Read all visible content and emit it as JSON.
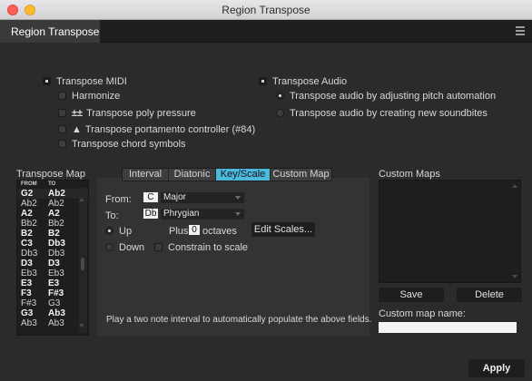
{
  "window": {
    "title": "Region Transpose"
  },
  "tab": {
    "label": "Region Transpose"
  },
  "midi": {
    "label": "Transpose MIDI",
    "checked": true,
    "options": [
      {
        "label": "Harmonize"
      },
      {
        "label": "Transpose poly pressure",
        "icon": "poly-pressure-icon",
        "glyph": "±±"
      },
      {
        "label": "Transpose portamento controller (#84)",
        "icon": "portamento-icon",
        "glyph": "▲"
      },
      {
        "label": "Transpose chord symbols"
      }
    ]
  },
  "audio": {
    "label": "Transpose Audio",
    "checked": true,
    "options": [
      {
        "label": "Transpose audio by adjusting pitch automation",
        "selected": true
      },
      {
        "label": "Transpose audio by creating new soundbites",
        "selected": false
      }
    ]
  },
  "transpose_map": {
    "title": "Transpose Map",
    "col_from": "FROM",
    "col_to": "TO",
    "rows": [
      {
        "from": "G2",
        "to": "Ab2",
        "bold": true
      },
      {
        "from": "Ab2",
        "to": "Ab2",
        "bold": false
      },
      {
        "from": "A2",
        "to": "A2",
        "bold": true
      },
      {
        "from": "Bb2",
        "to": "Bb2",
        "bold": false
      },
      {
        "from": "B2",
        "to": "B2",
        "bold": true
      },
      {
        "from": "C3",
        "to": "Db3",
        "bold": true
      },
      {
        "from": "Db3",
        "to": "Db3",
        "bold": false
      },
      {
        "from": "D3",
        "to": "D3",
        "bold": true
      },
      {
        "from": "Eb3",
        "to": "Eb3",
        "bold": false
      },
      {
        "from": "E3",
        "to": "E3",
        "bold": true
      },
      {
        "from": "F3",
        "to": "F#3",
        "bold": true
      },
      {
        "from": "F#3",
        "to": "G3",
        "bold": false
      },
      {
        "from": "G3",
        "to": "Ab3",
        "bold": true
      },
      {
        "from": "Ab3",
        "to": "Ab3",
        "bold": false
      }
    ]
  },
  "mode_tabs": [
    {
      "label": "Interval",
      "active": false
    },
    {
      "label": "Diatonic",
      "active": false
    },
    {
      "label": "Key/Scale",
      "active": true
    },
    {
      "label": "Custom Map",
      "active": false
    }
  ],
  "keyscale": {
    "from_label": "From:",
    "from_note": "C",
    "from_scale": "Major",
    "to_label": "To:",
    "to_note": "Db",
    "to_scale": "Phrygian",
    "up_label": "Up",
    "down_label": "Down",
    "direction": "Up",
    "plus_label": "Plus",
    "octaves_value": "0",
    "octaves_label": "octaves",
    "edit_scales_label": "Edit Scales...",
    "constrain_label": "Constrain to scale",
    "constrain_checked": false,
    "hint": "Play a two note interval to automatically populate the above fields."
  },
  "custom_maps": {
    "title": "Custom Maps",
    "save_label": "Save",
    "delete_label": "Delete",
    "name_label": "Custom map name:",
    "name_value": ""
  },
  "apply_label": "Apply",
  "colors": {
    "accent": "#4bb8dc",
    "background": "#2b2b2b"
  }
}
